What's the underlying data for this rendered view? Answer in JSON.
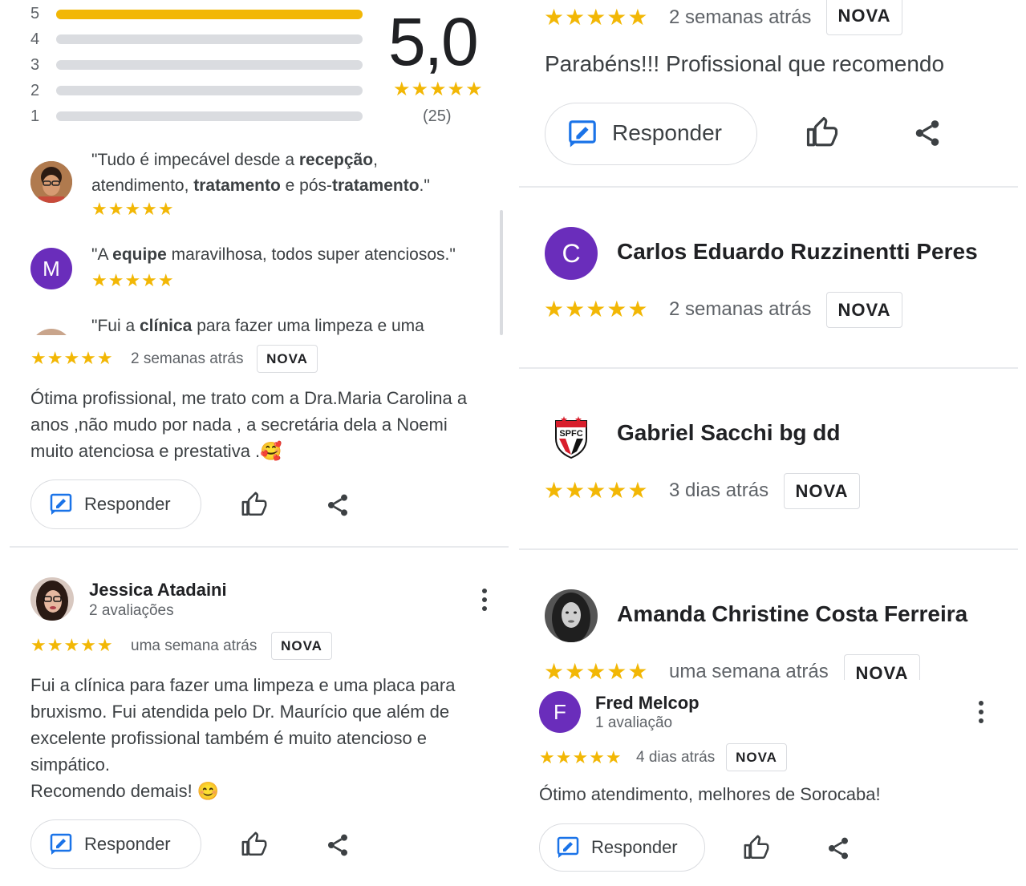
{
  "colors": {
    "star": "#F2B705",
    "avatar_purple": "#6a2dbb",
    "blue_icon": "#1a73e8"
  },
  "summary": {
    "rating": "5,0",
    "count": "(25)",
    "stars": "★★★★★",
    "bars": [
      {
        "label": "5",
        "fraction": 1.0
      },
      {
        "label": "4",
        "fraction": 0
      },
      {
        "label": "3",
        "fraction": 0
      },
      {
        "label": "2",
        "fraction": 0
      },
      {
        "label": "1",
        "fraction": 0
      }
    ]
  },
  "highlights": [
    {
      "parts": [
        "\"Tudo é impecável desde a ",
        "recepção",
        ",",
        "atendimento, ",
        "tratamento",
        " e pós-",
        "tratamento",
        ".\""
      ],
      "stars": "★★★★★"
    },
    {
      "avatar_letter": "M",
      "parts": [
        "\"A ",
        "equipe",
        " maravilhosa, todos super atenciosos.\""
      ],
      "stars": "★★★★★"
    },
    {
      "parts": [
        "\"Fui a ",
        "clínica",
        " para fazer uma limpeza e uma"
      ]
    }
  ],
  "labels": {
    "badge": "NOVA",
    "reply": "Responder"
  },
  "left_reviews": [
    {
      "stars": "★★★★★",
      "time": "2 semanas atrás",
      "text_lines": [
        "Ótima profissional, me trato com a Dra.Maria Carolina a",
        "anos ,não mudo por nada , a secretária dela a Noemi",
        "muito atenciosa e prestativa .🥰"
      ]
    },
    {
      "name": "Jessica Atadaini",
      "sub": "2 avaliações",
      "stars": "★★★★★",
      "time": "uma semana atrás",
      "text_lines": [
        "Fui a clínica para fazer uma limpeza e uma placa para",
        "bruxismo. Fui atendida pelo Dr. Maurício que além de",
        "excelente profissional também é muito atencioso e",
        "simpático.",
        "Recomendo demais! 😊"
      ]
    }
  ],
  "right_reviews": [
    {
      "stars": "★★★★★",
      "time": "2 semanas atrás",
      "text": "Parabéns!!! Profissional que recomendo"
    },
    {
      "avatar_letter": "C",
      "name": "Carlos Eduardo Ruzzinentti Peres",
      "stars": "★★★★★",
      "time": "2 semanas atrás"
    },
    {
      "avatar_text": "SPFC",
      "name": "Gabriel Sacchi bg dd",
      "stars": "★★★★★",
      "time": "3 dias atrás"
    },
    {
      "name": "Amanda Christine Costa Ferreira",
      "stars": "★★★★★",
      "time": "uma semana atrás"
    },
    {
      "avatar_letter": "F",
      "name": "Fred Melcop",
      "sub": "1 avaliação",
      "stars": "★★★★★",
      "time": "4 dias atrás",
      "text": "Ótimo atendimento, melhores de Sorocaba!"
    }
  ]
}
